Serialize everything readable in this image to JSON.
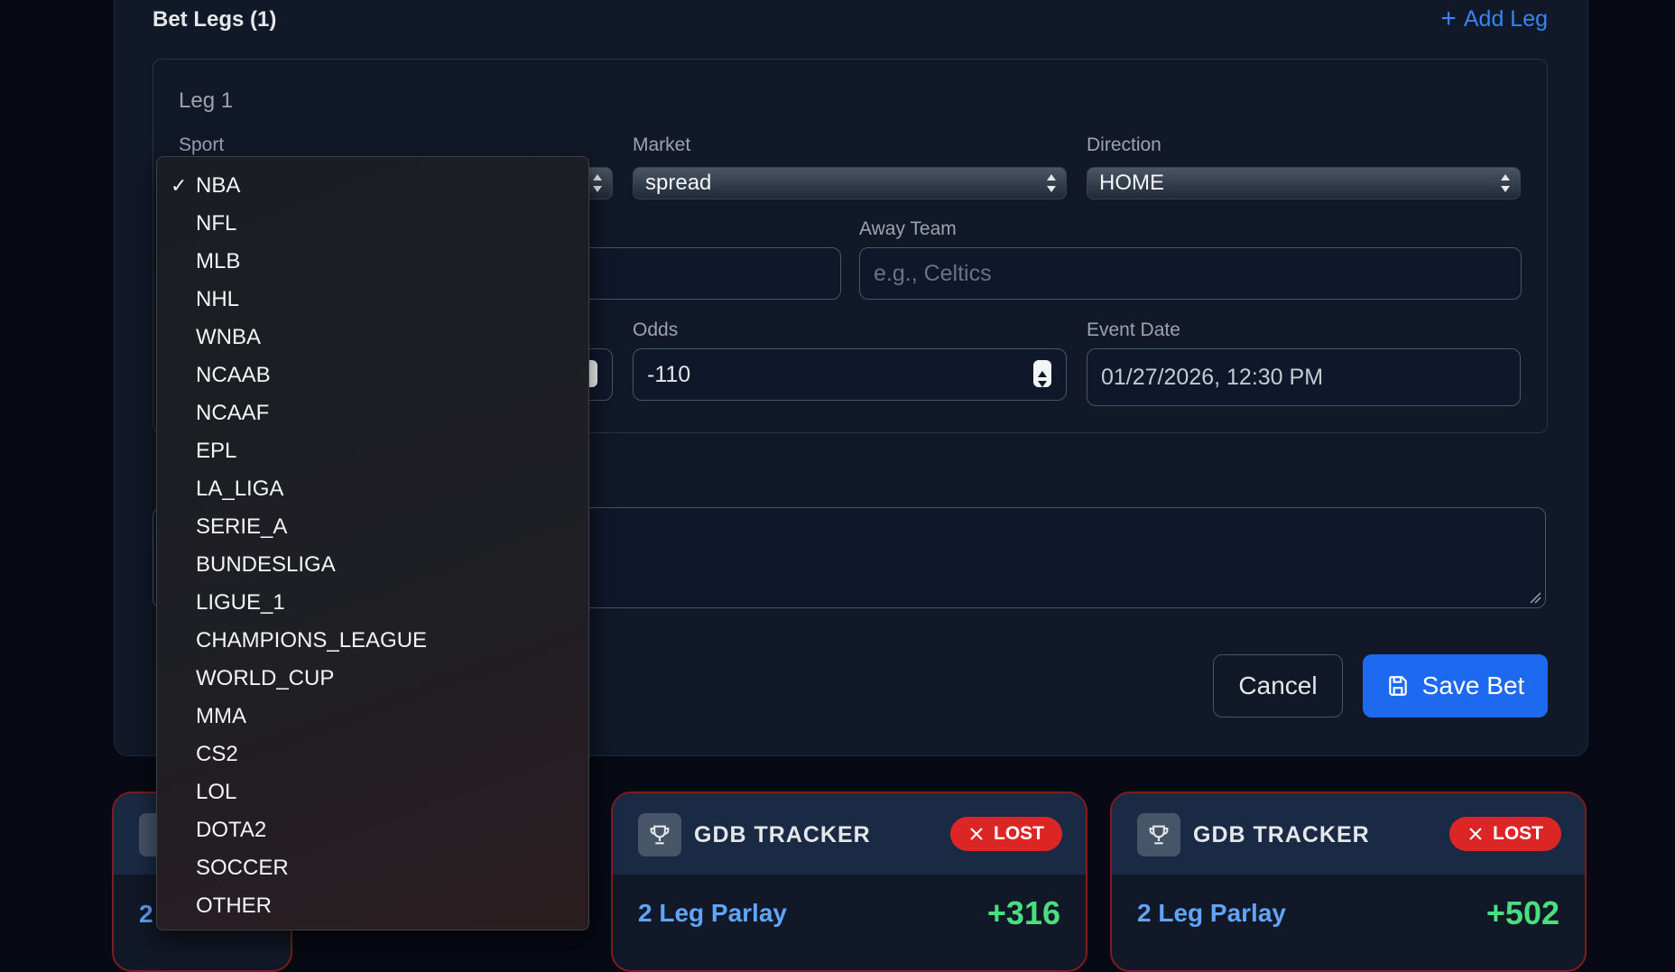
{
  "header": {
    "title": "Bet Legs (1)",
    "add_leg": "Add Leg"
  },
  "leg": {
    "title": "Leg 1",
    "sport_label": "Sport",
    "market_label": "Market",
    "market_value": "spread",
    "direction_label": "Direction",
    "direction_value": "HOME",
    "away_team_label": "Away Team",
    "away_team_placeholder": "e.g., Celtics",
    "odds_label": "Odds",
    "odds_value": "-110",
    "event_date_label": "Event Date",
    "event_date_value": "01/27/2026, 12:30 PM"
  },
  "actions": {
    "cancel": "Cancel",
    "save": "Save Bet"
  },
  "sport_dropdown": {
    "selected": "NBA",
    "options": [
      "NBA",
      "NFL",
      "MLB",
      "NHL",
      "WNBA",
      "NCAAB",
      "NCAAF",
      "EPL",
      "LA_LIGA",
      "SERIE_A",
      "BUNDESLIGA",
      "LIGUE_1",
      "CHAMPIONS_LEAGUE",
      "WORLD_CUP",
      "MMA",
      "CS2",
      "LOL",
      "DOTA2",
      "SOCCER",
      "OTHER"
    ]
  },
  "cards": [
    {
      "partial_text": "2"
    },
    {
      "title": "GDB TRACKER",
      "status": "LOST",
      "name": "2 Leg Parlay",
      "odds": "+316"
    },
    {
      "title": "GDB TRACKER",
      "status": "LOST",
      "name": "2 Leg Parlay",
      "odds": "+502"
    }
  ],
  "colors": {
    "accent": "#1d6af0",
    "lost": "#dc2626",
    "odds_positive": "#4ade80",
    "parlay_name": "#60a5fa"
  }
}
